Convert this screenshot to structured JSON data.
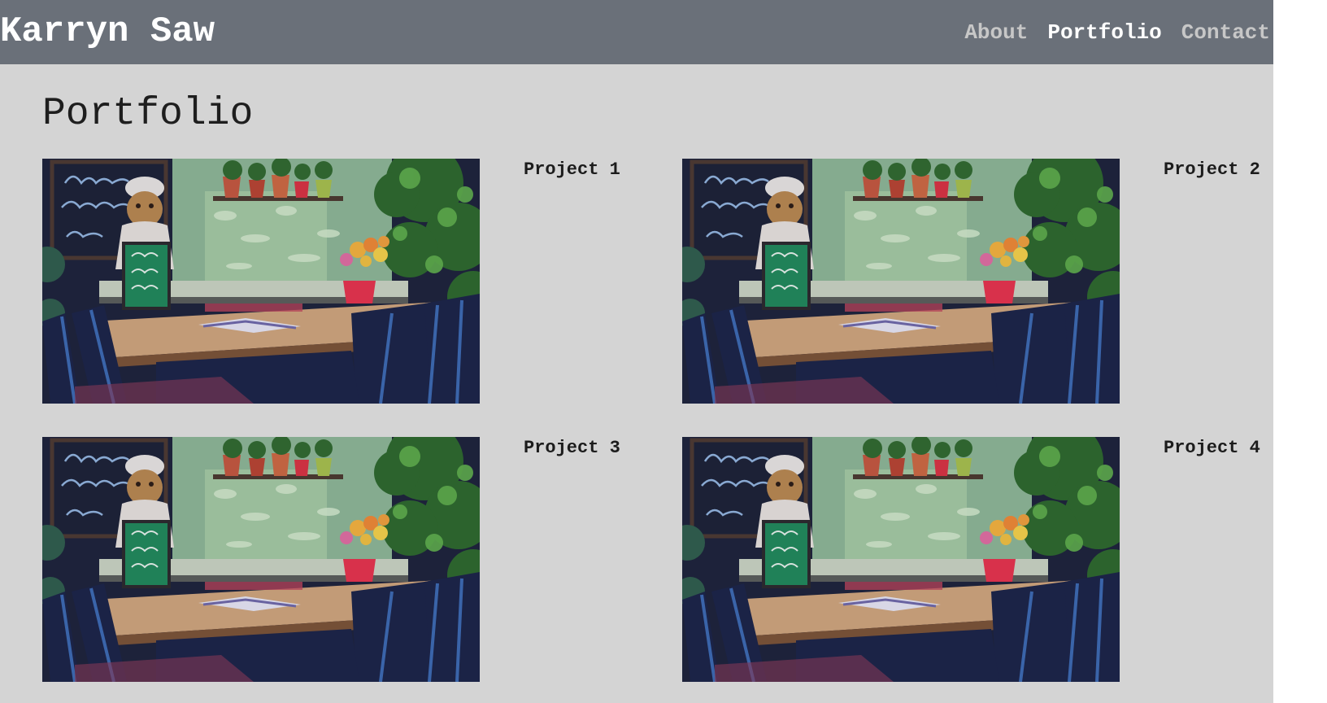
{
  "site": {
    "brand": "Karryn Saw"
  },
  "nav": {
    "items": [
      {
        "label": "About"
      },
      {
        "label": "Portfolio"
      },
      {
        "label": "Contact"
      }
    ]
  },
  "main": {
    "title": "Portfolio",
    "projects": [
      {
        "label": "Project 1"
      },
      {
        "label": "Project 2"
      },
      {
        "label": "Project 3"
      },
      {
        "label": "Project 4"
      }
    ]
  },
  "colors": {
    "header": "#6a7079",
    "page_background": "#d4d4d4",
    "nav_active": "#ffffff",
    "nav_inactive": "#c7c7c7"
  }
}
